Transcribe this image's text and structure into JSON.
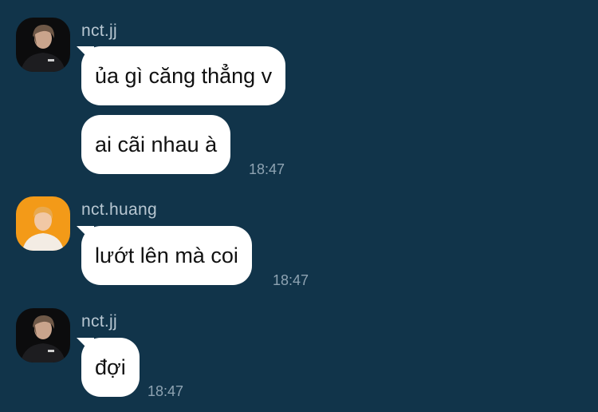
{
  "colors": {
    "background": "#11344a",
    "bubble": "#ffffff",
    "sender_text": "#b7c6d1",
    "time_text": "#8ea3b2"
  },
  "groups": [
    {
      "sender": "nct.jj",
      "avatar": "dark-portrait-avatar",
      "messages": [
        {
          "text": "ủa gì căng thẳng v",
          "time": ""
        },
        {
          "text": "ai cãi nhau à",
          "time": "18:47"
        }
      ]
    },
    {
      "sender": "nct.huang",
      "avatar": "orange-portrait-avatar",
      "messages": [
        {
          "text": "lướt lên mà coi",
          "time": "18:47"
        }
      ]
    },
    {
      "sender": "nct.jj",
      "avatar": "dark-portrait-avatar",
      "messages": [
        {
          "text": "đợi",
          "time": "18:47"
        }
      ]
    }
  ]
}
